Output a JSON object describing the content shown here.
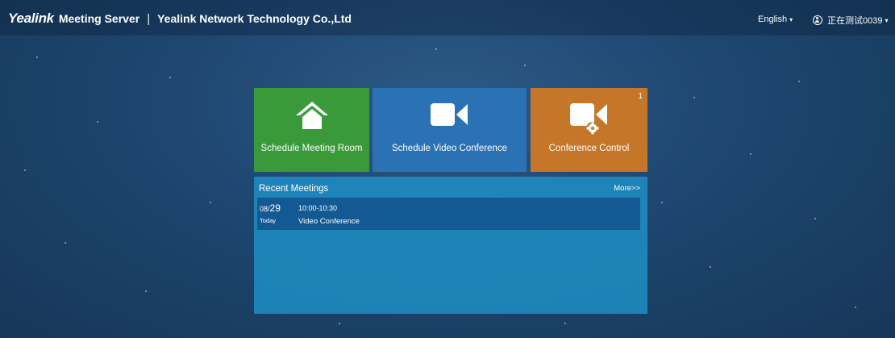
{
  "header": {
    "logo": "Yealink",
    "product": "Meeting Server",
    "separator": "|",
    "company": "Yealink Network Technology Co.,Ltd",
    "language": "English",
    "username": "正在测试0039"
  },
  "tiles": [
    {
      "label": "Schedule Meeting Room",
      "icon": "home-icon",
      "color": "#3a9a3a"
    },
    {
      "label": "Schedule Video Conference",
      "icon": "video-camera-icon",
      "color": "#2b72b4"
    },
    {
      "label": "Conference Control",
      "icon": "video-camera-gear-icon",
      "color": "#c67628",
      "badge": "1"
    }
  ],
  "recent": {
    "title": "Recent Meetings",
    "more": "More>>",
    "meetings": [
      {
        "month": "08/",
        "day": "29",
        "day_label": "Today",
        "time": "10:00-10:30",
        "title": "Video Conference"
      }
    ]
  }
}
